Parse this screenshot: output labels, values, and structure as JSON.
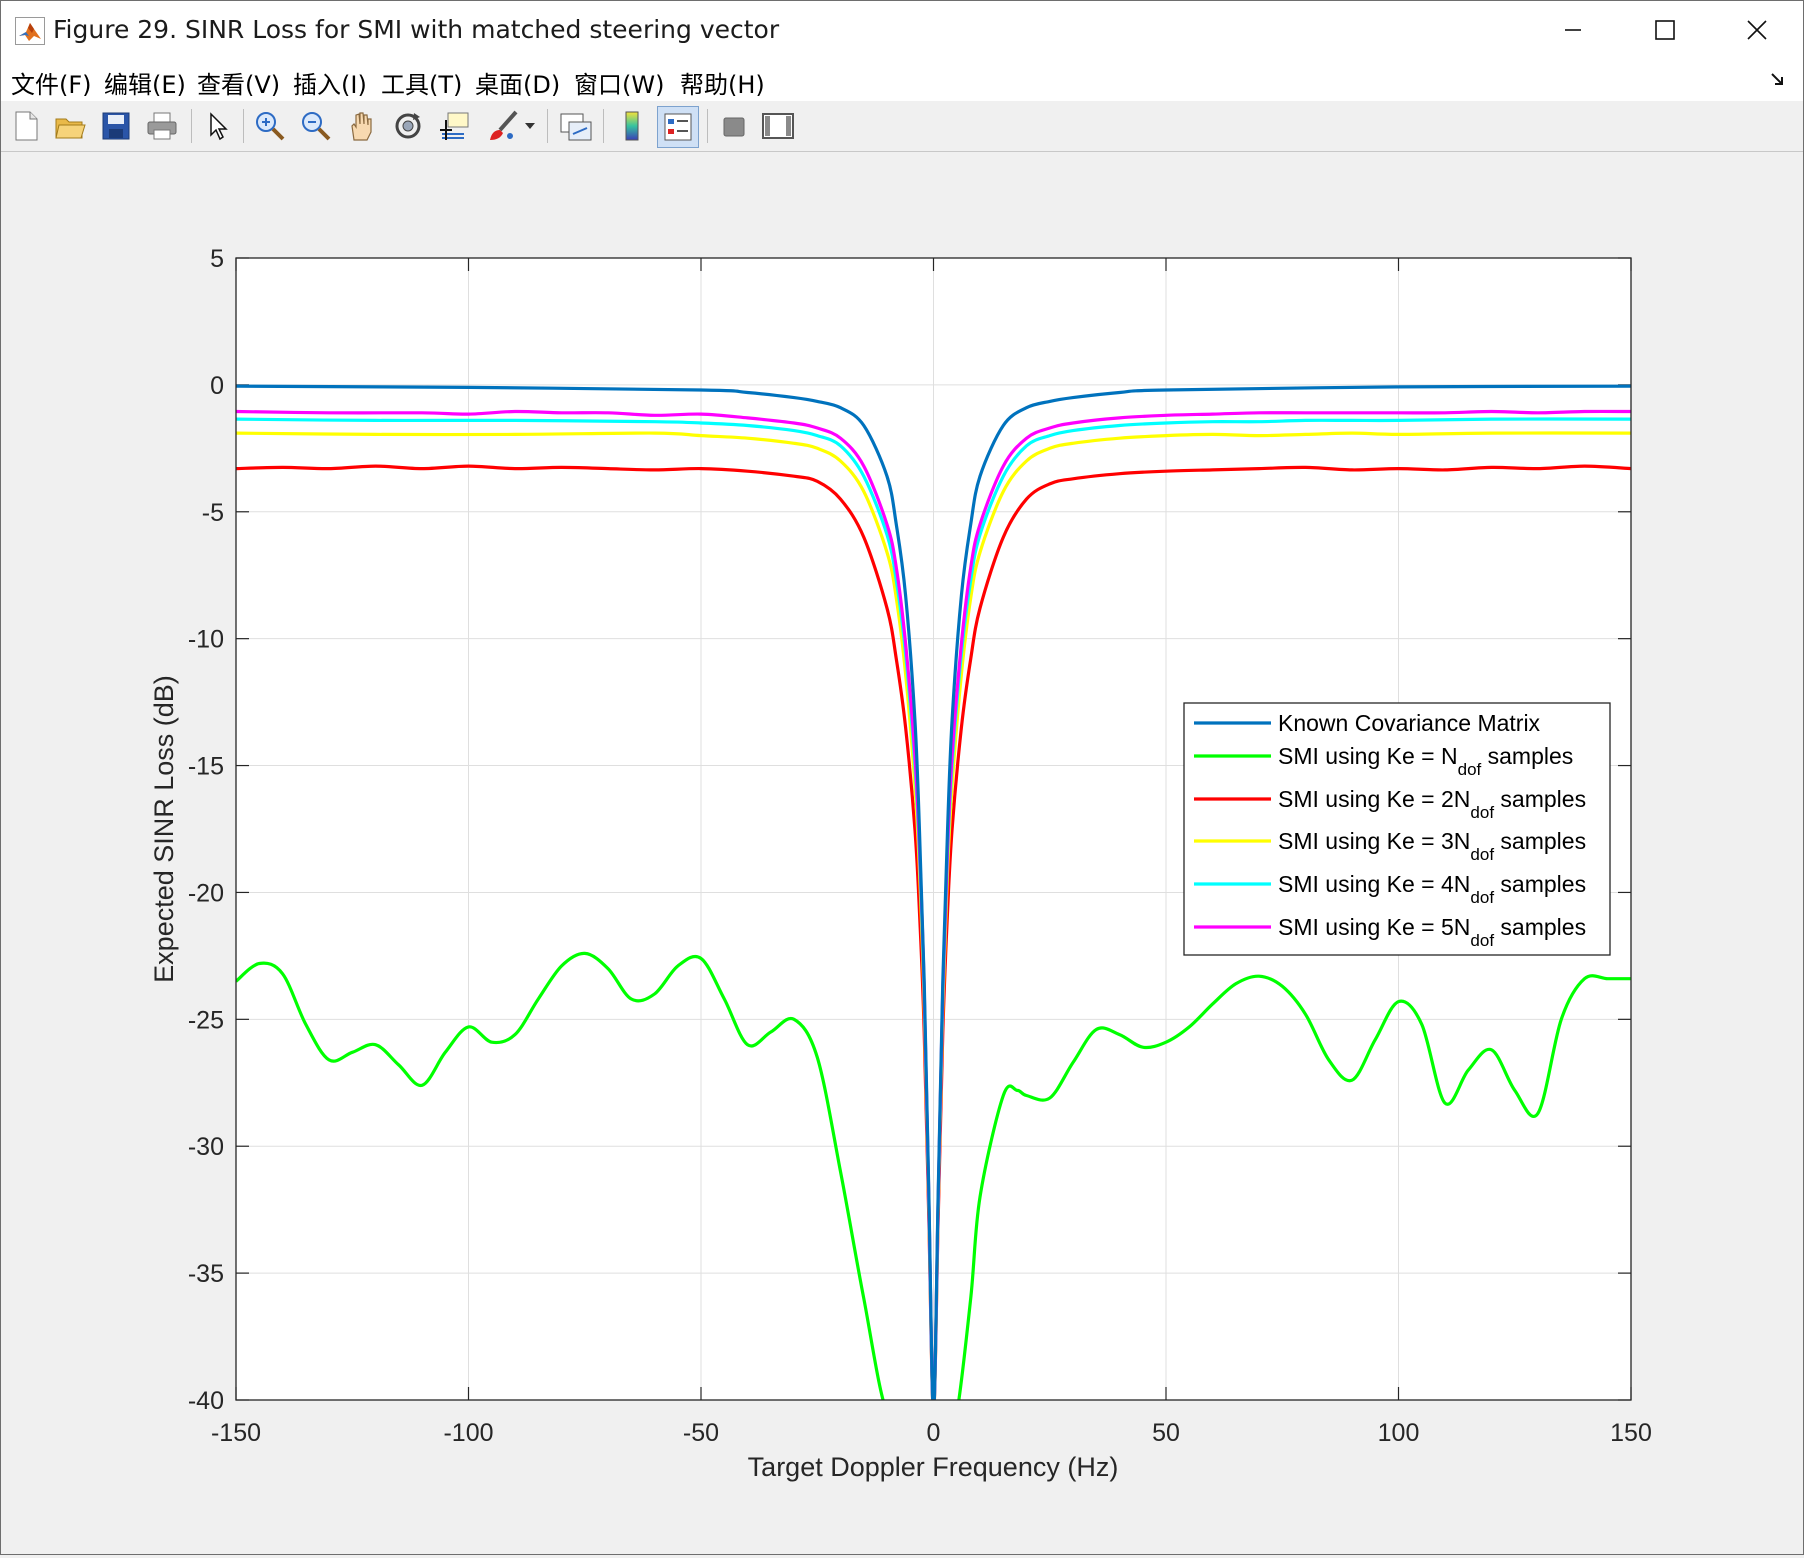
{
  "window": {
    "title": "Figure 29. SINR Loss for SMI with matched steering vector",
    "icon": "matlab-logo-icon"
  },
  "menu": [
    {
      "label": "文件(F)"
    },
    {
      "label": "编辑(E)"
    },
    {
      "label": "查看(V)"
    },
    {
      "label": "插入(I)"
    },
    {
      "label": "工具(T)"
    },
    {
      "label": "桌面(D)"
    },
    {
      "label": "窗口(W)"
    },
    {
      "label": "帮助(H)"
    }
  ],
  "toolbar": [
    {
      "name": "new-figure-button",
      "icon": "new-file-icon"
    },
    {
      "name": "open-file-button",
      "icon": "folder-open-icon"
    },
    {
      "name": "save-figure-button",
      "icon": "save-icon"
    },
    {
      "name": "print-figure-button",
      "icon": "printer-icon"
    },
    {
      "name": "edit-plot-button",
      "icon": "cursor-arrow-icon"
    },
    {
      "name": "zoom-in-button",
      "icon": "zoom-in-icon"
    },
    {
      "name": "zoom-out-button",
      "icon": "zoom-out-icon"
    },
    {
      "name": "pan-button",
      "icon": "hand-icon"
    },
    {
      "name": "rotate-3d-button",
      "icon": "rotate-icon"
    },
    {
      "name": "data-cursor-button",
      "icon": "data-cursor-icon"
    },
    {
      "name": "brush-button",
      "icon": "brush-icon"
    },
    {
      "name": "link-plot-button",
      "icon": "link-plot-icon"
    },
    {
      "name": "insert-colorbar-button",
      "icon": "colorbar-icon"
    },
    {
      "name": "insert-legend-button",
      "icon": "legend-icon"
    },
    {
      "name": "hide-plot-tools-button",
      "icon": "hide-tools-icon"
    },
    {
      "name": "show-plot-tools-button",
      "icon": "show-tools-icon"
    }
  ],
  "chart_data": {
    "type": "line",
    "title": "",
    "xlabel": "Target Doppler Frequency (Hz)",
    "ylabel": "Expected SINR Loss (dB)",
    "xlim": [
      -150,
      150
    ],
    "ylim": [
      -40,
      5
    ],
    "xticks": [
      -150,
      -100,
      -50,
      0,
      50,
      100,
      150
    ],
    "yticks": [
      5,
      0,
      -5,
      -10,
      -15,
      -20,
      -25,
      -30,
      -35,
      -40
    ],
    "xtick_labels": [
      "-150",
      "-100",
      "-50",
      "0",
      "50",
      "100",
      "150"
    ],
    "ytick_labels": [
      "5",
      "0",
      "-5",
      "-10",
      "-15",
      "-20",
      "-25",
      "-30",
      "-35",
      "-40"
    ],
    "grid": true,
    "legend_position": "right",
    "series": [
      {
        "name": "Known Covariance Matrix",
        "label_main": "Known Covariance Matrix",
        "label_sub": "",
        "label_tail": "",
        "color": "#0072bd",
        "x": [
          -150,
          -100,
          -50,
          -40,
          -30,
          -25,
          -20,
          -15,
          -10,
          -8,
          -6,
          -4,
          -3,
          -2,
          -1,
          0,
          1,
          2,
          3,
          4,
          6,
          8,
          10,
          15,
          20,
          25,
          30,
          40,
          50,
          100,
          150
        ],
        "y": [
          -0.05,
          -0.1,
          -0.2,
          -0.3,
          -0.5,
          -0.65,
          -0.9,
          -1.6,
          -3.6,
          -5.5,
          -8.3,
          -13.2,
          -17.6,
          -23.5,
          -32.0,
          -40.5,
          -32.0,
          -23.5,
          -17.6,
          -13.2,
          -8.3,
          -5.5,
          -3.6,
          -1.6,
          -0.9,
          -0.65,
          -0.5,
          -0.3,
          -0.2,
          -0.08,
          -0.05
        ]
      },
      {
        "name": "SMI using Ke = N",
        "label_main": "SMI using Ke = N",
        "label_sub": "dof",
        "label_tail": " samples",
        "color": "#00ff00",
        "x": [
          -150,
          -145,
          -140,
          -135,
          -130,
          -125,
          -120,
          -115,
          -110,
          -105,
          -100,
          -95,
          -90,
          -85,
          -80,
          -75,
          -70,
          -65,
          -60,
          -55,
          -50,
          -45,
          -40,
          -35,
          -30,
          -25,
          -20,
          -15,
          -10,
          -5,
          -3,
          -1,
          0,
          1,
          2,
          3,
          5,
          8,
          10,
          15,
          18,
          20,
          25,
          30,
          35,
          40,
          45,
          50,
          55,
          60,
          65,
          70,
          75,
          80,
          85,
          90,
          95,
          100,
          105,
          110,
          115,
          120,
          125,
          130,
          135,
          140,
          145,
          150
        ],
        "y": [
          -23.5,
          -22.8,
          -23.2,
          -25.2,
          -26.6,
          -26.3,
          -26.0,
          -26.8,
          -27.6,
          -26.3,
          -25.3,
          -25.9,
          -25.6,
          -24.2,
          -22.9,
          -22.4,
          -23.0,
          -24.2,
          -24.0,
          -22.9,
          -22.6,
          -24.2,
          -26.0,
          -25.5,
          -25.0,
          -26.5,
          -31.0,
          -36.0,
          -40.5,
          -40.5,
          -40.5,
          -40.5,
          -40.5,
          -40.5,
          -40.5,
          -40.5,
          -40.5,
          -36.0,
          -32.0,
          -28.0,
          -27.8,
          -28.0,
          -28.1,
          -26.7,
          -25.4,
          -25.6,
          -26.1,
          -25.9,
          -25.3,
          -24.4,
          -23.6,
          -23.3,
          -23.7,
          -24.8,
          -26.6,
          -27.4,
          -25.8,
          -24.3,
          -25.2,
          -28.3,
          -27.0,
          -26.2,
          -27.8,
          -28.7,
          -25.0,
          -23.4,
          -23.4,
          -23.4
        ]
      },
      {
        "name": "SMI using Ke = 2N",
        "label_main": "SMI using Ke = 2N",
        "label_sub": "dof",
        "label_tail": " samples",
        "color": "#ff0000",
        "x": [
          -150,
          -140,
          -130,
          -120,
          -110,
          -100,
          -90,
          -80,
          -70,
          -60,
          -50,
          -40,
          -30,
          -25,
          -20,
          -15,
          -10,
          -8,
          -6,
          -4,
          -3,
          -2,
          -1,
          0,
          1,
          2,
          3,
          4,
          6,
          8,
          10,
          15,
          20,
          25,
          30,
          40,
          50,
          60,
          70,
          80,
          90,
          100,
          110,
          120,
          130,
          140,
          150
        ],
        "y": [
          -3.3,
          -3.25,
          -3.3,
          -3.2,
          -3.3,
          -3.2,
          -3.3,
          -3.25,
          -3.3,
          -3.35,
          -3.3,
          -3.4,
          -3.6,
          -3.8,
          -4.5,
          -6.0,
          -8.8,
          -10.8,
          -13.5,
          -17.5,
          -20.8,
          -25.5,
          -33.0,
          -40.5,
          -33.0,
          -25.5,
          -20.8,
          -17.5,
          -13.5,
          -10.8,
          -8.8,
          -6.0,
          -4.5,
          -3.9,
          -3.7,
          -3.5,
          -3.4,
          -3.35,
          -3.3,
          -3.25,
          -3.35,
          -3.3,
          -3.35,
          -3.25,
          -3.3,
          -3.2,
          -3.3
        ]
      },
      {
        "name": "SMI using Ke = 3N",
        "label_main": "SMI using Ke = 3N",
        "label_sub": "dof",
        "label_tail": " samples",
        "color": "#ffff00",
        "x": [
          -150,
          -120,
          -90,
          -60,
          -50,
          -40,
          -30,
          -25,
          -20,
          -15,
          -10,
          -8,
          -6,
          -4,
          -3,
          -2,
          -1,
          0,
          1,
          2,
          3,
          4,
          6,
          8,
          10,
          15,
          20,
          25,
          30,
          40,
          50,
          60,
          70,
          80,
          90,
          100,
          120,
          150
        ],
        "y": [
          -1.9,
          -1.95,
          -1.95,
          -1.9,
          -2.0,
          -2.1,
          -2.3,
          -2.5,
          -3.0,
          -4.2,
          -6.6,
          -8.4,
          -11.4,
          -15.8,
          -19.2,
          -24.5,
          -32.5,
          -40.5,
          -32.5,
          -24.5,
          -19.2,
          -15.8,
          -11.4,
          -8.4,
          -6.6,
          -4.2,
          -3.0,
          -2.5,
          -2.3,
          -2.1,
          -2.0,
          -1.95,
          -2.0,
          -1.95,
          -1.9,
          -1.95,
          -1.9,
          -1.9
        ]
      },
      {
        "name": "SMI using Ke = 4N",
        "label_main": "SMI using Ke = 4N",
        "label_sub": "dof",
        "label_tail": " samples",
        "color": "#00ffff",
        "x": [
          -150,
          -120,
          -90,
          -60,
          -50,
          -40,
          -30,
          -25,
          -20,
          -15,
          -10,
          -8,
          -6,
          -4,
          -3,
          -2,
          -1,
          0,
          1,
          2,
          3,
          4,
          6,
          8,
          10,
          15,
          20,
          25,
          30,
          40,
          50,
          60,
          70,
          80,
          90,
          100,
          120,
          150
        ],
        "y": [
          -1.35,
          -1.4,
          -1.4,
          -1.45,
          -1.5,
          -1.6,
          -1.8,
          -2.0,
          -2.4,
          -3.6,
          -5.9,
          -7.7,
          -10.6,
          -15.0,
          -18.6,
          -24.0,
          -32.3,
          -40.5,
          -32.3,
          -24.0,
          -18.6,
          -15.0,
          -10.6,
          -7.7,
          -5.9,
          -3.6,
          -2.4,
          -2.0,
          -1.8,
          -1.6,
          -1.5,
          -1.45,
          -1.45,
          -1.4,
          -1.4,
          -1.4,
          -1.35,
          -1.35
        ]
      },
      {
        "name": "SMI using Ke = 5N",
        "label_main": "SMI using Ke = 5N",
        "label_sub": "dof",
        "label_tail": " samples",
        "color": "#ff00ff",
        "x": [
          -150,
          -130,
          -110,
          -100,
          -90,
          -80,
          -70,
          -60,
          -50,
          -40,
          -30,
          -25,
          -20,
          -15,
          -10,
          -8,
          -6,
          -4,
          -3,
          -2,
          -1,
          0,
          1,
          2,
          3,
          4,
          6,
          8,
          10,
          15,
          20,
          25,
          30,
          40,
          50,
          60,
          70,
          80,
          90,
          100,
          110,
          120,
          130,
          140,
          150
        ],
        "y": [
          -1.05,
          -1.1,
          -1.1,
          -1.15,
          -1.05,
          -1.1,
          -1.1,
          -1.2,
          -1.15,
          -1.3,
          -1.5,
          -1.7,
          -2.1,
          -3.2,
          -5.5,
          -7.2,
          -10.2,
          -14.6,
          -18.3,
          -23.8,
          -32.2,
          -40.5,
          -32.2,
          -23.8,
          -18.3,
          -14.6,
          -10.2,
          -7.2,
          -5.5,
          -3.2,
          -2.1,
          -1.7,
          -1.5,
          -1.3,
          -1.2,
          -1.15,
          -1.1,
          -1.1,
          -1.1,
          -1.1,
          -1.1,
          -1.05,
          -1.1,
          -1.05,
          -1.05
        ]
      }
    ]
  }
}
